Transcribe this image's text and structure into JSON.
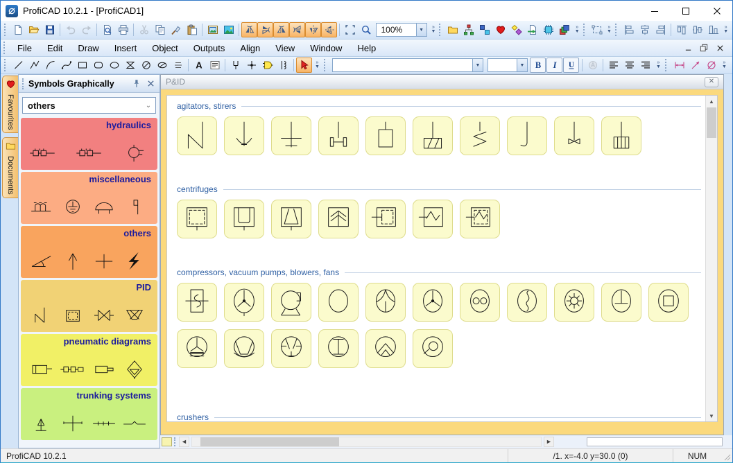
{
  "window": {
    "title": "ProfiCAD 10.2.1 - [ProfiCAD1]"
  },
  "menubar": {
    "items": [
      "File",
      "Edit",
      "Draw",
      "Insert",
      "Object",
      "Outputs",
      "Align",
      "View",
      "Window",
      "Help"
    ]
  },
  "toolbar1": {
    "zoom_value": "100%",
    "groups": {
      "file": [
        {
          "icon": "new"
        },
        {
          "icon": "open"
        },
        {
          "icon": "save"
        },
        {
          "sep": true
        },
        {
          "icon": "undo",
          "state": "disabled"
        },
        {
          "icon": "redo",
          "state": "disabled"
        },
        {
          "sep": true
        },
        {
          "icon": "print-preview"
        },
        {
          "icon": "print"
        },
        {
          "sep": true
        },
        {
          "icon": "cut",
          "state": "disabled"
        },
        {
          "icon": "copy"
        },
        {
          "icon": "format-painter"
        },
        {
          "icon": "paste"
        },
        {
          "sep": true
        },
        {
          "icon": "image-frame"
        },
        {
          "icon": "image"
        },
        {
          "sep": true
        },
        {
          "icon": "rotate-left",
          "state": "active"
        },
        {
          "icon": "flip-up",
          "state": "active"
        },
        {
          "icon": "rotate-right",
          "state": "active"
        },
        {
          "icon": "flip-down",
          "state": "active"
        },
        {
          "icon": "mirror-horizontal",
          "state": "active"
        },
        {
          "icon": "mirror-left",
          "state": "active"
        },
        {
          "sep": true
        },
        {
          "icon": "select-area"
        },
        {
          "icon": "zoom-lens"
        }
      ],
      "library": [
        {
          "icon": "folder-yellow"
        },
        {
          "icon": "scheme-network"
        },
        {
          "icon": "symbols-pair"
        },
        {
          "icon": "favourites-heart"
        },
        {
          "icon": "color-shapes"
        },
        {
          "icon": "page-export"
        },
        {
          "icon": "chip"
        },
        {
          "icon": "layers"
        }
      ],
      "group": [
        {
          "icon": "group-rect"
        }
      ],
      "align": [
        {
          "icon": "align-left"
        },
        {
          "icon": "align-center-h"
        },
        {
          "icon": "align-right"
        },
        {
          "sep": true
        },
        {
          "icon": "align-top"
        },
        {
          "icon": "align-middle"
        },
        {
          "icon": "align-bottom"
        }
      ]
    }
  },
  "toolbar2": {
    "font_value": "",
    "size_value": "",
    "groups": {
      "draw": [
        {
          "icon": "line"
        },
        {
          "icon": "polyline"
        },
        {
          "icon": "arc"
        },
        {
          "icon": "bezier"
        },
        {
          "icon": "rectangle"
        },
        {
          "icon": "rounded-rectangle"
        },
        {
          "icon": "ellipse"
        },
        {
          "icon": "hourglass"
        },
        {
          "icon": "circle-crossed"
        },
        {
          "icon": "ellipse-crossed"
        },
        {
          "icon": "hatch-lines"
        },
        {
          "sep": true
        },
        {
          "icon": "text-a"
        },
        {
          "icon": "text-block"
        },
        {
          "sep": true
        },
        {
          "icon": "connector-fork"
        },
        {
          "icon": "junction-cross"
        },
        {
          "icon": "gate-d"
        },
        {
          "icon": "coil"
        },
        {
          "sep": true
        },
        {
          "icon": "pointer-red",
          "state": "active"
        }
      ],
      "format": [
        {
          "icon": "bold",
          "fmt": true
        },
        {
          "icon": "italic",
          "fmt": true
        },
        {
          "icon": "underline",
          "fmt": true
        },
        {
          "sep": true
        },
        {
          "icon": "font-color",
          "state": "disabled"
        },
        {
          "sep": true
        },
        {
          "icon": "talign-left"
        },
        {
          "icon": "talign-center"
        },
        {
          "icon": "talign-right"
        }
      ],
      "dimension": [
        {
          "icon": "dim-linear"
        },
        {
          "icon": "dim-arrow"
        },
        {
          "icon": "dim-diameter"
        }
      ]
    }
  },
  "sidebar": {
    "title": "Symbols Graphically",
    "dropdown_value": "others",
    "tabs": [
      {
        "label": "Favourites",
        "icon": "favourites-heart"
      },
      {
        "label": "Documents",
        "icon": "folder-yellow"
      }
    ],
    "categories": [
      {
        "label": "hydraulics",
        "color": "#f28080",
        "symbols": [
          "hyd-train",
          "hyd-train",
          "hyd-pump"
        ]
      },
      {
        "label": "miscellaneous",
        "color": "#fcac83",
        "symbols": [
          "misc-fence",
          "misc-earth",
          "misc-dome",
          "misc-flag"
        ]
      },
      {
        "label": "others",
        "color": "#f9a45e",
        "symbols": [
          "oth-angle",
          "oth-arrow",
          "oth-plus",
          "oth-bolt"
        ]
      },
      {
        "label": "PID",
        "color": "#f1d275",
        "symbols": [
          "pid-zigzag",
          "pid-box",
          "pid-valve",
          "pid-funnel"
        ]
      },
      {
        "label": "pneumatic diagrams",
        "color": "#f1f066",
        "symbols": [
          "pn-cyl",
          "pn-train",
          "pn-cyl2",
          "pn-filter"
        ]
      },
      {
        "label": "trunking systems",
        "color": "#c9f07f",
        "symbols": [
          "tr-mast",
          "tr-cross",
          "tr-ticks",
          "tr-dot"
        ]
      }
    ]
  },
  "document": {
    "title": "P&ID",
    "groups": [
      {
        "label": "agitators, stirers",
        "symbols": [
          "ag-zigzag",
          "ag-anchor",
          "ag-crossbar",
          "ag-impeller",
          "ag-frame",
          "ag-hatched",
          "ag-helical",
          "ag-hook",
          "ag-propeller",
          "ag-turbine"
        ]
      },
      {
        "label": "centrifuges",
        "symbols": [
          "ce-dashed",
          "ce-basket",
          "ce-cone",
          "ce-chevrons",
          "ce-pusher",
          "ce-vibrating",
          "ce-vibrating-dashed"
        ]
      },
      {
        "label": "compressors, vacuum pumps, blowers, fans",
        "symbols": [
          "co-duct-fan",
          "co-axial-fan",
          "co-liquid-ring",
          "co-ellipse",
          "co-radial",
          "co-fan3",
          "co-roots",
          "co-screw",
          "co-gear",
          "co-piston",
          "co-rotary",
          "co2-prop",
          "co2-trap",
          "co2-tee",
          "co2-ibeam",
          "co2-chevron",
          "co2-ring"
        ]
      },
      {
        "label": "crushers",
        "symbols": []
      }
    ]
  },
  "statusbar": {
    "app": "ProfiCAD 10.2.1",
    "coords": "/1.  x=-4.0  y=30.0 (0)",
    "num": "NUM"
  }
}
